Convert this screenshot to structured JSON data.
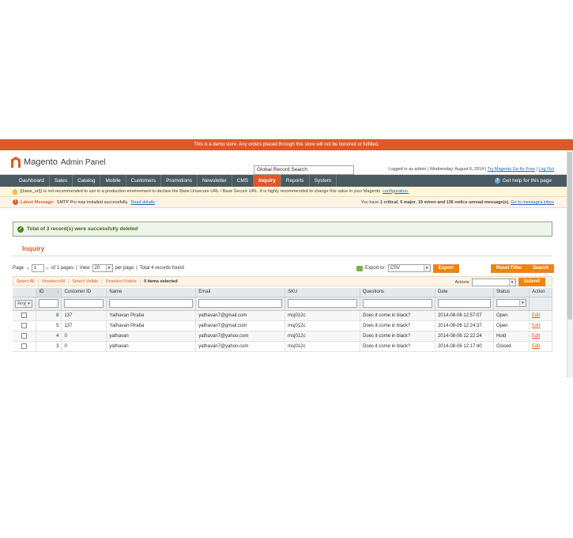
{
  "demo_bar": "This is a demo store. Any orders placed through this store will not be honored or fulfilled.",
  "logo": {
    "brand": "Magento",
    "sub": "Admin Panel"
  },
  "header": {
    "search_value": "Global Record Search",
    "logged_in": "Logged in as admin",
    "date": "Wednesday, August 6, 2014",
    "try_link": "Try Magento Go for Free",
    "logout": "Log Out"
  },
  "nav": {
    "items": [
      "Dashboard",
      "Sales",
      "Catalog",
      "Mobile",
      "Customers",
      "Promotions",
      "Newsletter",
      "CMS",
      "Inquiry",
      "Reports",
      "System"
    ],
    "active": "Inquiry",
    "help": "Get help for this page"
  },
  "notice": {
    "text": "{{base_url}} is not recommended to use in a production environment to declare the Base Unsecure URL / Base Secure URL. It is highly recommended to change this value in your Magento",
    "link": "configuration."
  },
  "latest": {
    "label": "Latest Message:",
    "text": "SMTP Pro was installed successfully.",
    "link": "Read details",
    "summary_prefix": "You have",
    "critical": "1 critical",
    "major": "5 major",
    "minor": "19 minor and",
    "notice_count": "136 notice unread message(s).",
    "inbox_link": "Go to messages inbox"
  },
  "success_message": "Total of 3 record(s) were successfully deleted",
  "page_title": "Inquiry",
  "pager": {
    "page_label": "Page",
    "page_value": "1",
    "of_pages": "of 1 pages",
    "view_label": "View",
    "per_page_value": "20",
    "per_page_label": "per page",
    "total": "Total 4 records found"
  },
  "export": {
    "label": "Export to:",
    "format": "CSV",
    "button": "Export"
  },
  "buttons": {
    "reset": "Reset Filter",
    "search": "Search"
  },
  "massaction": {
    "select_all": "Select All",
    "unselect_all": "Unselect All",
    "select_visible": "Select Visible",
    "unselect_visible": "Unselect Visible",
    "selected": "0 items selected",
    "actions_label": "Actions",
    "submit": "Submit"
  },
  "grid": {
    "columns": [
      "",
      "ID",
      "Customer ID",
      "Name",
      "Email",
      "SKU",
      "Questions",
      "Date",
      "Status",
      "Action"
    ],
    "filter_any": "Any",
    "rows": [
      {
        "id": "8",
        "customer_id": "137",
        "name": "Yathavan Piraba",
        "email": "yathavan7@gmail.com",
        "sku": "msj012c",
        "question": "Does it come in black?",
        "date": "2014-08-06 12:57:07",
        "status": "Open",
        "action": "Edit"
      },
      {
        "id": "5",
        "customer_id": "137",
        "name": "Yathavan Piraba",
        "email": "yathavan7@gmail.com",
        "sku": "msj012c",
        "question": "Does it come in black?",
        "date": "2014-08-06 12:24:37",
        "status": "Open",
        "action": "Edit"
      },
      {
        "id": "4",
        "customer_id": "0",
        "name": "yathavan",
        "email": "yathavan7@yahoo.com",
        "sku": "msj012c",
        "question": "Does it come in black?",
        "date": "2014-08-06 12:22:24",
        "status": "Hold",
        "action": "Edit"
      },
      {
        "id": "3",
        "customer_id": "0",
        "name": "yathavan",
        "email": "yathavan7@yahoo.com",
        "sku": "msj012c",
        "question": "Does it come in black?",
        "date": "2014-08-06 12:17:40",
        "status": "Closed",
        "action": "Edit"
      }
    ]
  },
  "colors": {
    "brand": "#e0582a",
    "nav": "#4a5a61",
    "button": "#f18200",
    "success": "#3d6611"
  }
}
